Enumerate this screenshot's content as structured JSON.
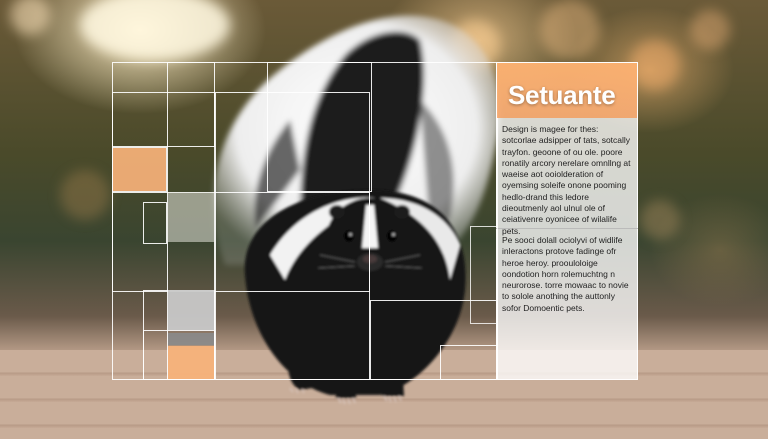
{
  "panel": {
    "title": "Setuante",
    "paragraph_1": "Design is magee for thes: sotcorlae adsipper of tats, sotcally trayfon. geoone of ou ole. poore ronatily arcory nerelare omnllng at waeise aot ooiolderation of oyemsing soleife onone pooming hedlo-drand this ledore dieoutmenly aol ulnul ole of ceiativenre oyonicee of wilalife pets.",
    "paragraph_2": "Pe sooci dolall ociolyvi of widlife inleractons protove fadinge ofr heroe heroy. proouloloige oondotion horn rolemuchtng n neurorose. torre mowaac to novie to solole anothing the auttonly sofor Domoentic pets."
  },
  "colors": {
    "accent_orange": "#f7b27a",
    "frame_white": "#ffffff",
    "swatch_gray": "#c8c8c8",
    "swatch_dark_gray": "#8a8a8a"
  }
}
